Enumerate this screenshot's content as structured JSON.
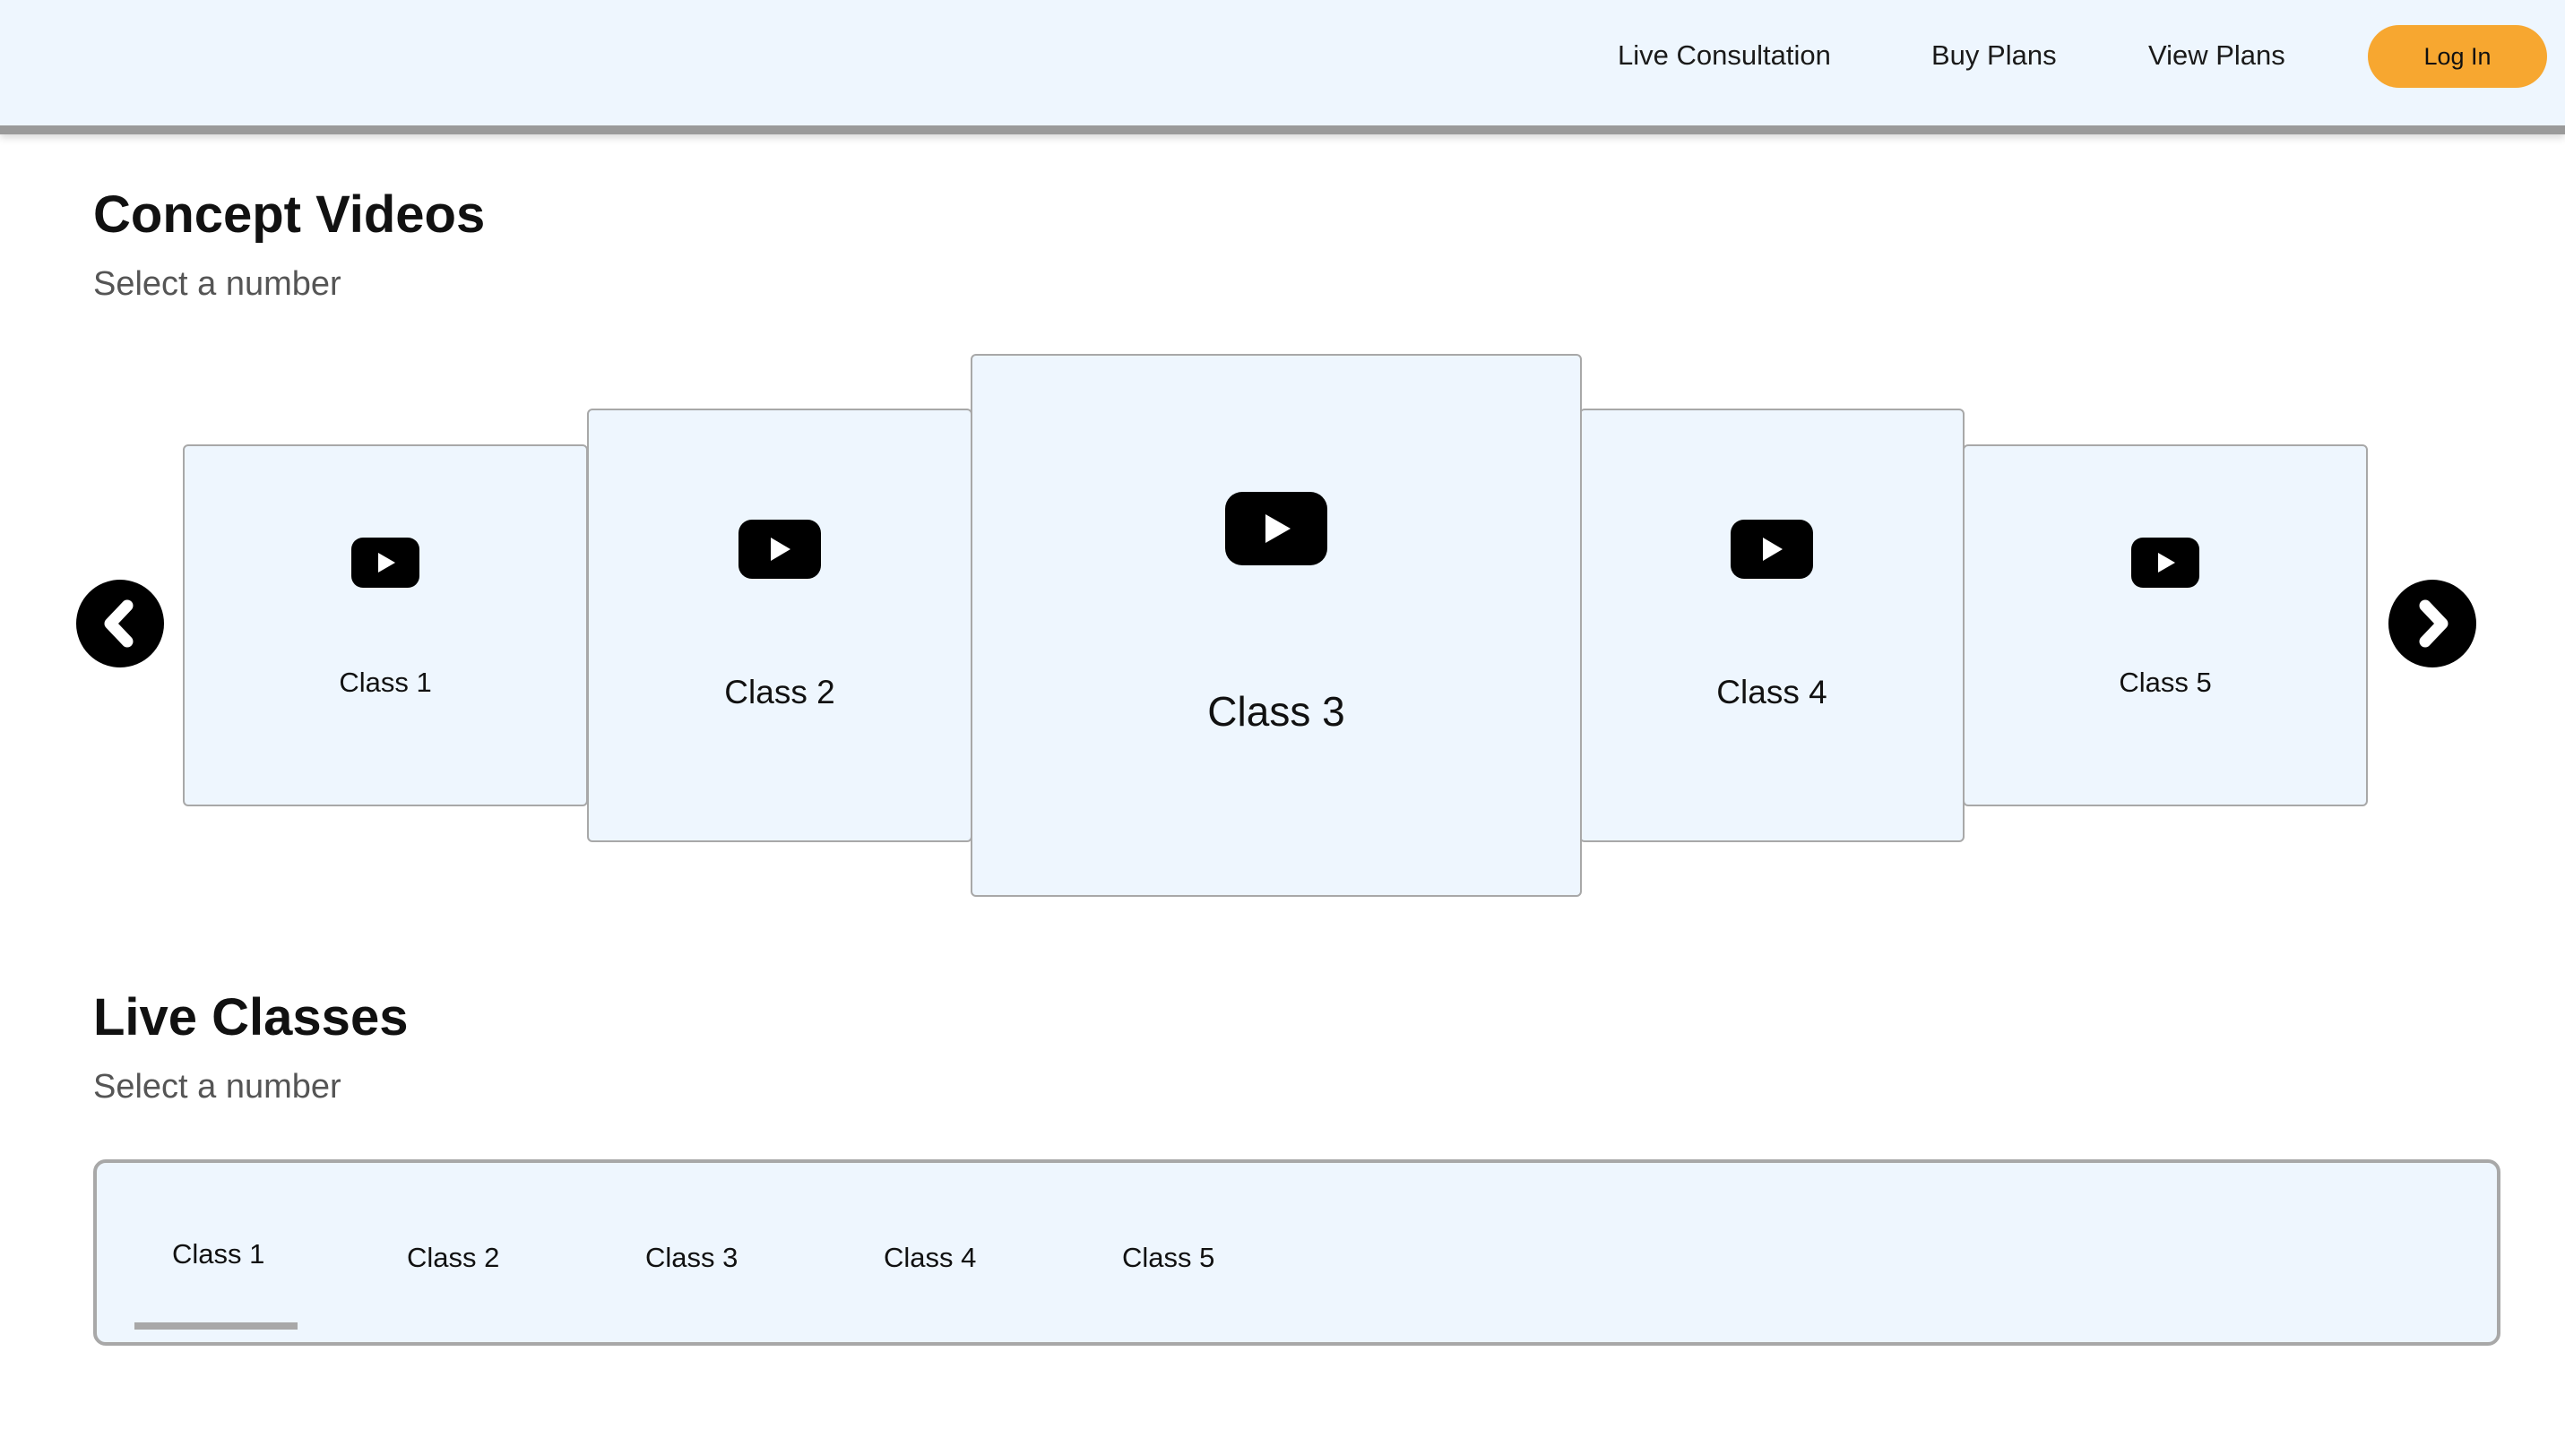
{
  "header": {
    "nav": [
      "Live Consultation",
      "Buy Plans",
      "View Plans"
    ],
    "login_label": "Log In"
  },
  "concept_videos": {
    "title": "Concept Videos",
    "subtitle": "Select a number",
    "cards": [
      {
        "label": "Class 1",
        "icon": "youtube-play-icon"
      },
      {
        "label": "Class 2",
        "icon": "youtube-play-icon"
      },
      {
        "label": "Class 3",
        "icon": "youtube-play-icon"
      },
      {
        "label": "Class 4",
        "icon": "youtube-play-icon"
      },
      {
        "label": "Class 5",
        "icon": "youtube-play-icon"
      }
    ],
    "prev_icon": "chevron-left-icon",
    "next_icon": "chevron-right-icon"
  },
  "live_classes": {
    "title": "Live Classes",
    "subtitle": "Select a number",
    "tabs": [
      "Class 1",
      "Class 2",
      "Class 3",
      "Class 4",
      "Class 5"
    ],
    "selected_tab": "Class 1"
  },
  "colors": {
    "header_bg": "#eef6fe",
    "card_bg": "#eef6fe",
    "accent": "#f7a730",
    "border": "#a8a8a8"
  }
}
